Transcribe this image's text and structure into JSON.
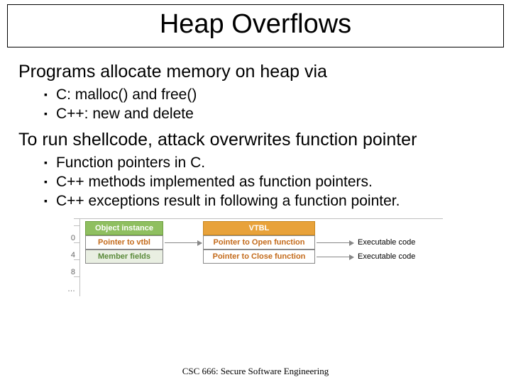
{
  "title": "Heap Overflows",
  "lead1": "Programs allocate memory on heap via",
  "list1": {
    "i0": "C: malloc() and free()",
    "i1": "C++: new and delete"
  },
  "lead2": "To run shellcode, attack overwrites function pointer",
  "list2": {
    "i0": "Function pointers in C.",
    "i1": "C++ methods implemented as function pointers.",
    "i2": "C++ exceptions result in following a function pointer."
  },
  "diagram": {
    "ticks": {
      "t0": "0",
      "t1": "4",
      "t2": "8",
      "t3": "…"
    },
    "obj_header": "Object instance",
    "obj_ptr": "Pointer to vtbl",
    "obj_fields": "Member fields",
    "vtbl_header": "VTBL",
    "vtbl_open": "Pointer to Open function",
    "vtbl_close": "Pointer to Close function",
    "exec1": "Executable code",
    "exec2": "Executable code"
  },
  "footer": "CSC 666: Secure Software Engineering"
}
